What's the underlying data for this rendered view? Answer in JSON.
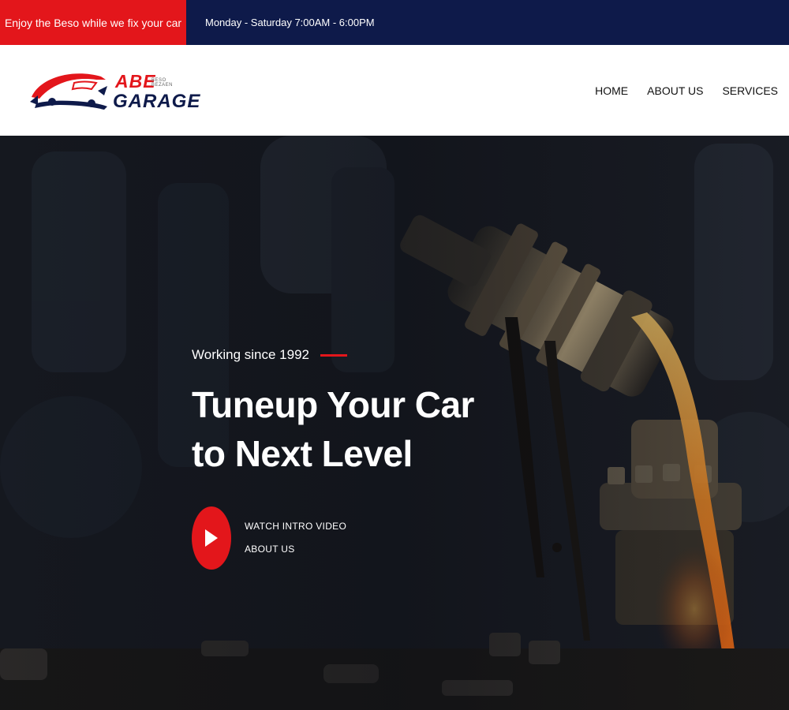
{
  "topbar": {
    "promo": "Enjoy the Beso while we fix your car",
    "hours": "Monday - Saturday 7:00AM - 6:00PM"
  },
  "logo": {
    "line1": "ABE",
    "line2": "GARAGE",
    "tagline": "BESO BEZAEN"
  },
  "nav": {
    "items": [
      "HOME",
      "ABOUT US",
      "SERVICES"
    ]
  },
  "hero": {
    "eyebrow": "Working since 1992",
    "headline_line1": "Tuneup Your Car",
    "headline_line2": "to Next Level",
    "video_label": "WATCH INTRO VIDEO",
    "video_sublabel": "ABOUT US",
    "play_icon": "play-icon",
    "background": "engine-oil-pour-photo"
  },
  "colors": {
    "accent": "#e3161b",
    "navy": "#0e1a4a",
    "white": "#ffffff"
  }
}
